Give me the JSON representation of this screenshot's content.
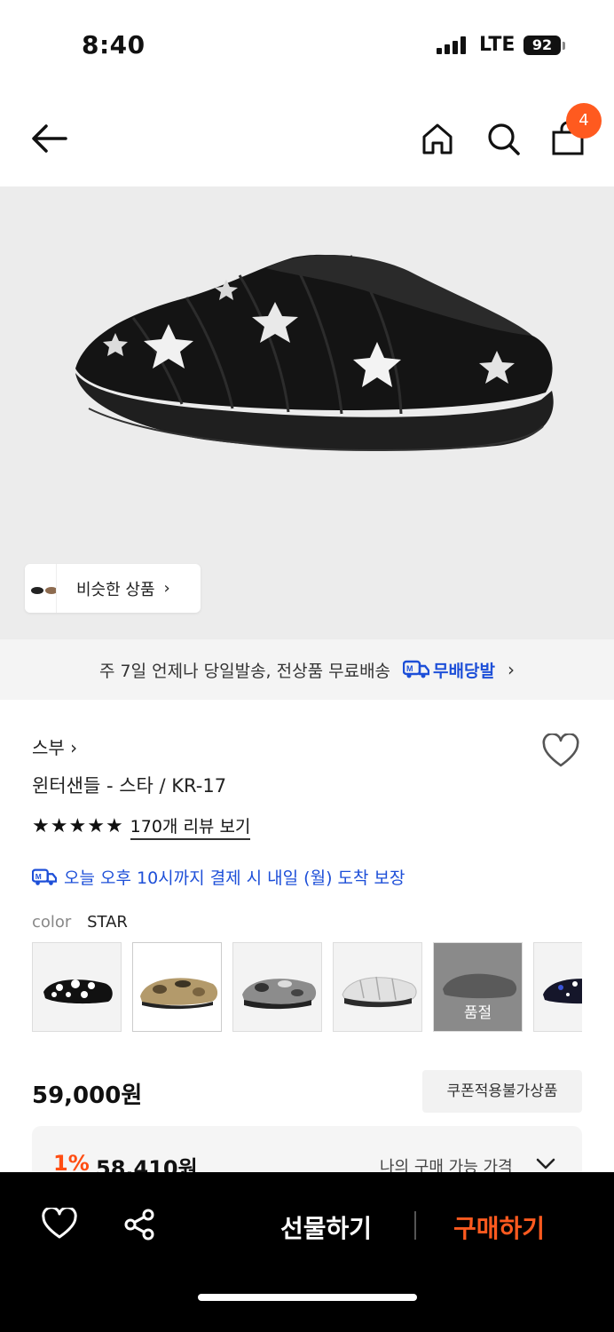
{
  "status_bar": {
    "time": "8:40",
    "network": "LTE",
    "battery": "92"
  },
  "header": {
    "cart_count": "4"
  },
  "hero": {
    "similar_label": "비슷한 상품"
  },
  "delivery": {
    "text": "주 7일 언제나 당일발송, 전상품 무료배송",
    "brand": "무배당발"
  },
  "product": {
    "brand": "스부 ›",
    "title": "윈터샌들 - 스타 / KR-17",
    "rating_stars": 5,
    "reviews_label": "170개 리뷰 보기",
    "guarantee": "오늘 오후 10시까지 결제 시 내일 (월) 도착 보장",
    "color_label": "color",
    "color_value": "STAR",
    "swatches": [
      {
        "name": "dots",
        "soldout": false
      },
      {
        "name": "camo",
        "soldout": false,
        "selected": true
      },
      {
        "name": "grey-camo",
        "soldout": false
      },
      {
        "name": "silver",
        "soldout": false
      },
      {
        "name": "grey",
        "soldout": true,
        "label": "품절"
      },
      {
        "name": "navy-dots",
        "soldout": false
      }
    ],
    "price": "59,000원",
    "coupon_tag": "쿠폰적용불가상품",
    "my_discount_pct": "1%",
    "my_price": "58,410원",
    "my_price_label": "나의 구매 가능 가격"
  },
  "bottom_bar": {
    "gift_label": "선물하기",
    "buy_label": "구매하기"
  },
  "colors": {
    "accent": "#ff5a1f",
    "blue": "#1d4fd8"
  }
}
